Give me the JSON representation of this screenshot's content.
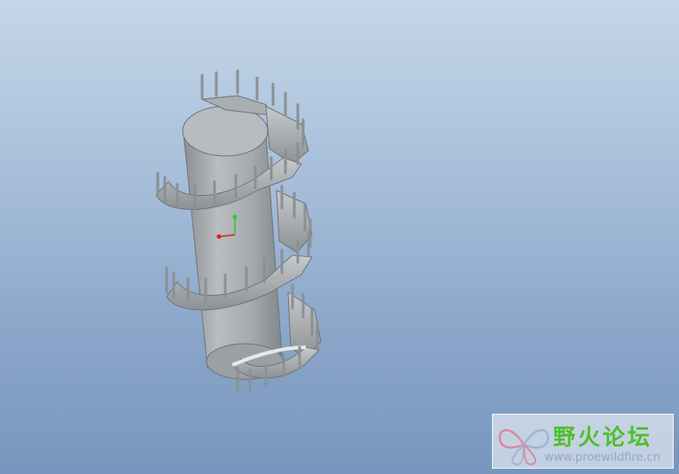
{
  "viewport": {
    "background_top": "#c4d6e8",
    "background_bottom": "#7896bd",
    "model_color": "#a9aeb2",
    "axis_triad": {
      "y_color": "#22cc33",
      "x_color": "#dd2222"
    }
  },
  "watermark": {
    "title": "野火论坛",
    "url": "www.proewildfire.cn",
    "title_color": "#4fbf2a",
    "logo_icon": "butterfly-icon"
  }
}
